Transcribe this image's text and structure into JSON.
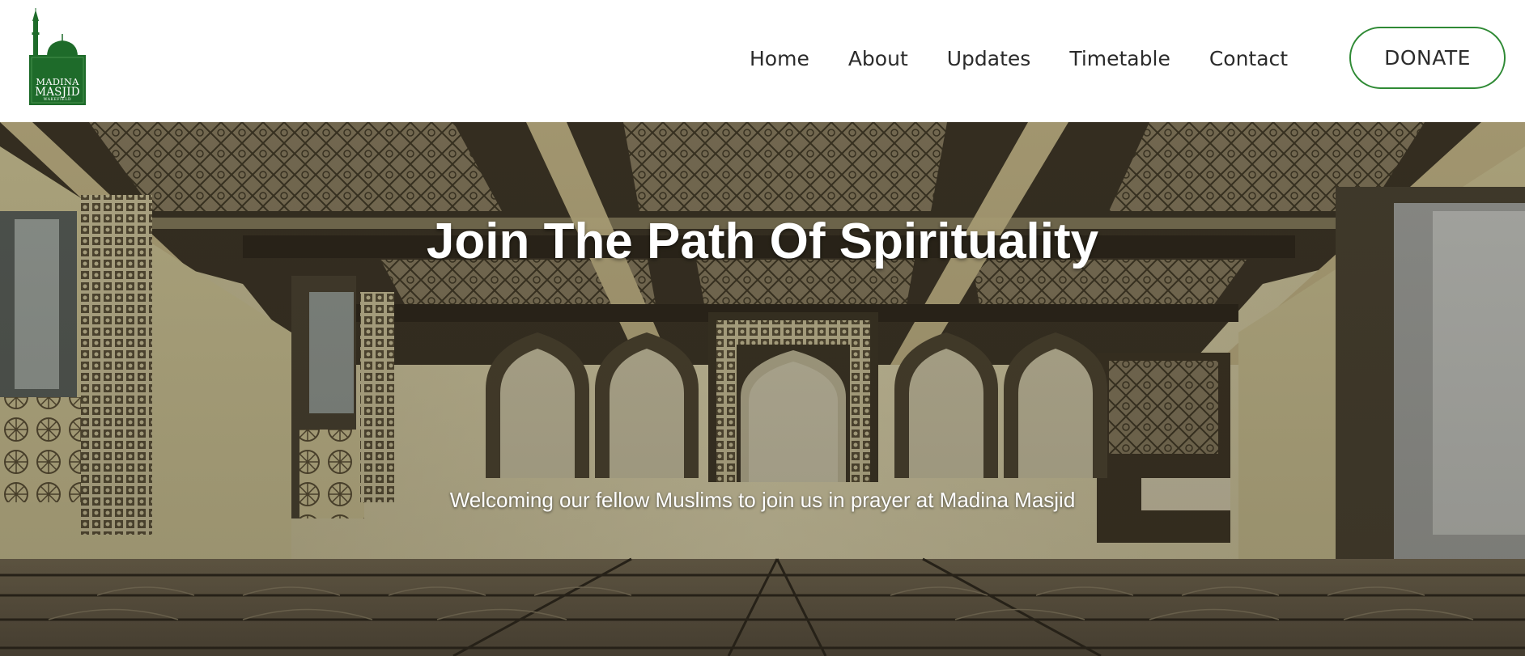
{
  "logo": {
    "line1": "MADINA",
    "line2": "MASJID",
    "line3": "WAKEFIELD",
    "icon": "mosque-icon",
    "color": "#1e6b2a"
  },
  "nav": {
    "items": [
      "Home",
      "About",
      "Updates",
      "Timetable",
      "Contact"
    ],
    "donate_label": "DONATE",
    "accent": "#2f8a35"
  },
  "hero": {
    "title": "Join The Path Of Spirituality",
    "subtitle": "Welcoming our fellow Muslims to join us in prayer at Madina Masjid",
    "image": "mosque-prayer-hall-interior"
  }
}
